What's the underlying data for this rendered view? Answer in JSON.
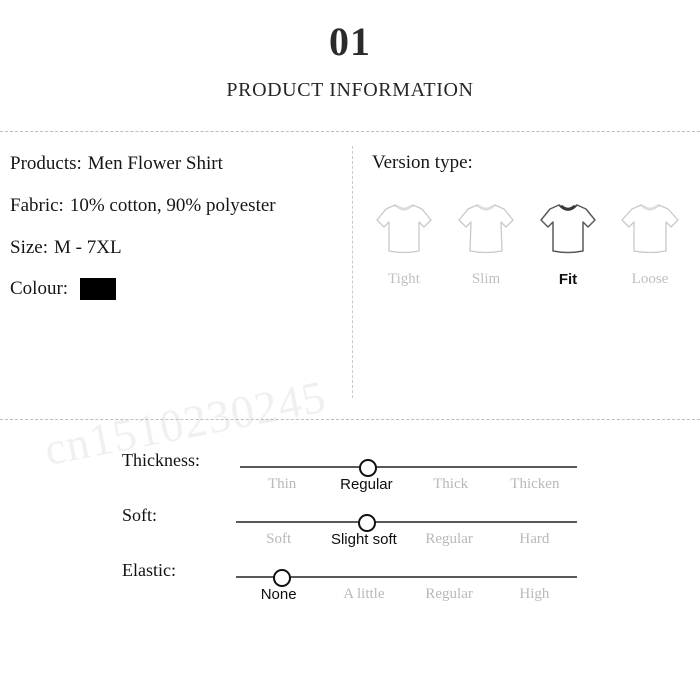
{
  "header": {
    "number": "01",
    "title": "PRODUCT INFORMATION"
  },
  "watermark": {
    "text": "cn1510230245"
  },
  "specs": {
    "products": {
      "label": "Products:",
      "value": "Men Flower Shirt"
    },
    "fabric": {
      "label": "Fabric:",
      "value": "10% cotton, 90% polyester"
    },
    "size": {
      "label": "Size:",
      "value": "M - 7XL"
    },
    "colour": {
      "label": "Colour:",
      "swatch_color": "#000000"
    }
  },
  "version": {
    "title": "Version type:",
    "selected": "Fit",
    "options": [
      {
        "label": "Tight",
        "selected": false
      },
      {
        "label": "Slim",
        "selected": false
      },
      {
        "label": "Fit",
        "selected": true
      },
      {
        "label": "Loose",
        "selected": false
      }
    ]
  },
  "sliders": [
    {
      "name": "Thickness:",
      "selected": "Regular",
      "ticks": [
        "Thin",
        "Regular",
        "Thick",
        "Thicken"
      ]
    },
    {
      "name": "Soft:",
      "selected": "Slight soft",
      "ticks": [
        "Soft",
        "Slight soft",
        "Regular",
        "Hard"
      ]
    },
    {
      "name": "Elastic:",
      "selected": "None",
      "ticks": [
        "None",
        "A little",
        "Regular",
        "High"
      ]
    }
  ],
  "colors": {
    "text": "#161616",
    "muted": "#bcbcbc",
    "divider": "#bdbdbd",
    "track": "#595959",
    "shirt_outline": "#c9c9c9",
    "shirt_outline_selected": "#4a4a4a"
  }
}
